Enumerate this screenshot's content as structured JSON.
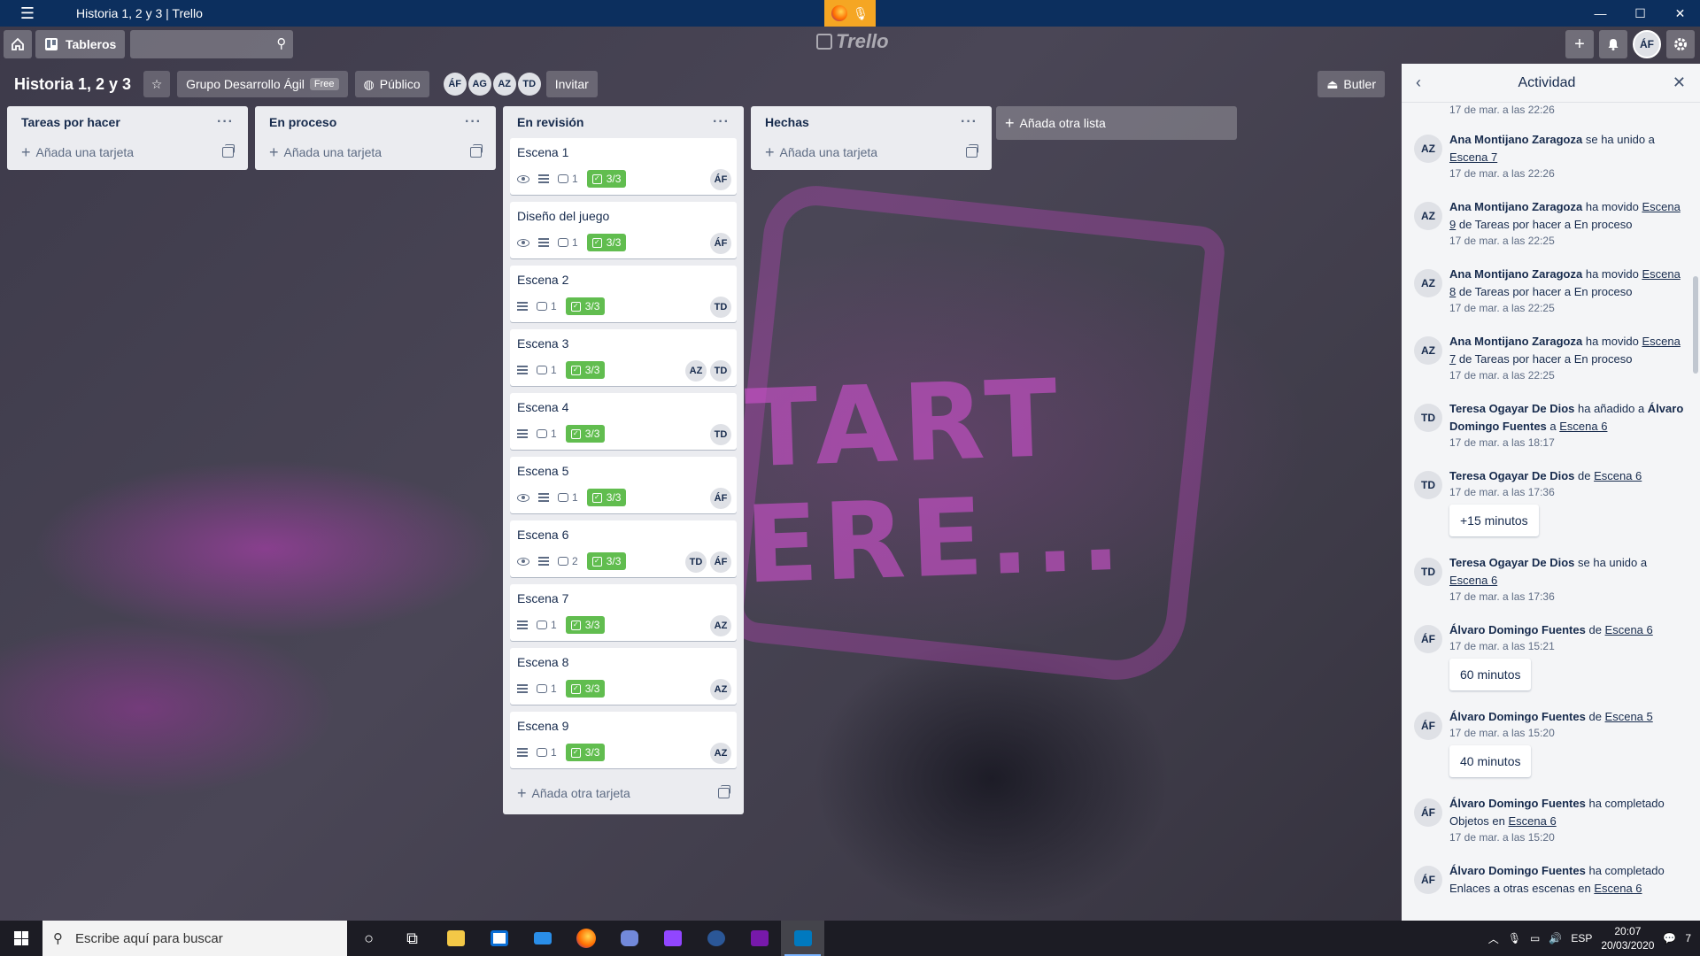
{
  "window": {
    "title": "Historia 1, 2 y 3 | Trello",
    "controls": [
      "—",
      "☐",
      "✕"
    ]
  },
  "header": {
    "boards_label": "Tableros",
    "logo": "Trello",
    "me_initials": "ÁF"
  },
  "board": {
    "title": "Historia 1, 2 y 3",
    "team": "Grupo Desarrollo Ágil",
    "team_badge": "Free",
    "visibility": "Público",
    "members": [
      "ÁF",
      "AG",
      "AZ",
      "TD"
    ],
    "invite_label": "Invitar",
    "butler_label": "Butler",
    "add_list_label": "Añada otra lista"
  },
  "lists": [
    {
      "title": "Tareas por hacer",
      "add_label": "Añada una tarjeta"
    },
    {
      "title": "En proceso",
      "add_label": "Añada una tarjeta"
    },
    {
      "title": "En revisión",
      "add_label": "Añada otra tarjeta"
    },
    {
      "title": "Hechas",
      "add_label": "Añada una tarjeta"
    }
  ],
  "cards": [
    {
      "title": "Escena 1",
      "comments": "1",
      "checklist": "3/3",
      "members": [
        "ÁF"
      ]
    },
    {
      "title": "Diseño del juego",
      "comments": "1",
      "checklist": "3/3",
      "members": [
        "ÁF"
      ]
    },
    {
      "title": "Escena 2",
      "comments": "1",
      "checklist": "3/3",
      "members": [
        "TD"
      ]
    },
    {
      "title": "Escena 3",
      "comments": "1",
      "checklist": "3/3",
      "members": [
        "AZ",
        "TD"
      ]
    },
    {
      "title": "Escena 4",
      "comments": "1",
      "checklist": "3/3",
      "members": [
        "TD"
      ]
    },
    {
      "title": "Escena 5",
      "comments": "1",
      "checklist": "3/3",
      "members": [
        "ÁF"
      ]
    },
    {
      "title": "Escena 6",
      "comments": "2",
      "checklist": "3/3",
      "members": [
        "TD",
        "ÁF"
      ]
    },
    {
      "title": "Escena 7",
      "comments": "1",
      "checklist": "3/3",
      "members": [
        "AZ"
      ]
    },
    {
      "title": "Escena 8",
      "comments": "1",
      "checklist": "3/3",
      "members": [
        "AZ"
      ]
    },
    {
      "title": "Escena 9",
      "comments": "1",
      "checklist": "3/3",
      "members": [
        "AZ"
      ]
    }
  ],
  "activity": {
    "title": "Actividad",
    "first_date": "17 de mar. a las 22:26",
    "items": [
      {
        "av": "AZ",
        "name": "Ana Montijano Zaragoza",
        "text": " se ha unido a ",
        "link": "Escena 7",
        "date": "17 de mar. a las 22:26"
      },
      {
        "av": "AZ",
        "name": "Ana Montijano Zaragoza",
        "text": " ha movido ",
        "link": "Escena 9",
        "text2": " de Tareas por hacer a En proceso",
        "date": "17 de mar. a las 22:25"
      },
      {
        "av": "AZ",
        "name": "Ana Montijano Zaragoza",
        "text": " ha movido ",
        "link": "Escena 8",
        "text2": " de Tareas por hacer a En proceso",
        "date": "17 de mar. a las 22:25"
      },
      {
        "av": "AZ",
        "name": "Ana Montijano Zaragoza",
        "text": " ha movido ",
        "link": "Escena 7",
        "text2": " de Tareas por hacer a En proceso",
        "date": "17 de mar. a las 22:25"
      },
      {
        "av": "TD",
        "name": "Teresa Ogayar De Dios",
        "text": " ha añadido a ",
        "name2": "Álvaro Domingo Fuentes",
        "text2": " a ",
        "link": "Escena 6",
        "date": "17 de mar. a las 18:17"
      },
      {
        "av": "TD",
        "name": "Teresa Ogayar De Dios",
        "text": " de ",
        "link": "Escena 6",
        "date": "17 de mar. a las 17:36",
        "comment": "+15 minutos"
      },
      {
        "av": "TD",
        "name": "Teresa Ogayar De Dios",
        "text": " se ha unido a ",
        "link": "Escena 6",
        "date": "17 de mar. a las 17:36"
      },
      {
        "av": "ÁF",
        "name": "Álvaro Domingo Fuentes",
        "text": " de ",
        "link": "Escena 6",
        "date": "17 de mar. a las 15:21",
        "comment": "60 minutos"
      },
      {
        "av": "ÁF",
        "name": "Álvaro Domingo Fuentes",
        "text": " de ",
        "link": "Escena 5",
        "date": "17 de mar. a las 15:20",
        "comment": "40 minutos"
      },
      {
        "av": "ÁF",
        "name": "Álvaro Domingo Fuentes",
        "text": " ha completado Objetos en ",
        "link": "Escena 6",
        "date": "17 de mar. a las 15:20"
      },
      {
        "av": "ÁF",
        "name": "Álvaro Domingo Fuentes",
        "text": " ha completado Enlaces a otras escenas en ",
        "link": "Escena 6",
        "date": ""
      }
    ]
  },
  "taskbar": {
    "search_placeholder": "Escribe aquí para buscar",
    "lang": "ESP",
    "time": "20:07",
    "date": "20/03/2020",
    "notif_count": "7"
  },
  "background": {
    "text_line1": "TART",
    "text_line2": "ERE..."
  },
  "colors": {
    "checklist_complete": "#61bd4f",
    "titlebar": "#0c2f5e",
    "list_bg": "#ebecf0"
  }
}
